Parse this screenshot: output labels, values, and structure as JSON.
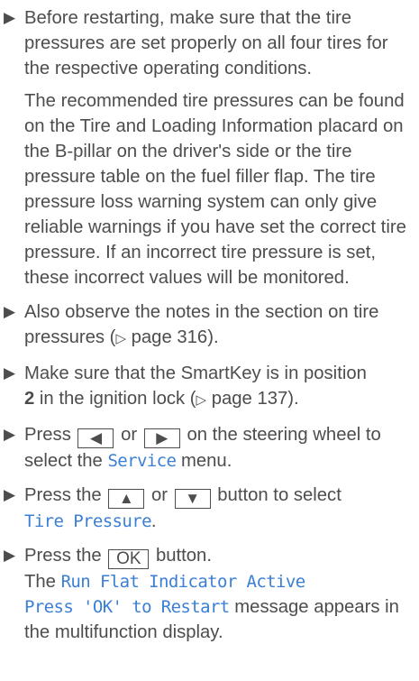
{
  "step1": {
    "text": "Before restarting, make sure that the tire pressures are set properly on all four tires for the respective operating conditions."
  },
  "note1": {
    "text": "The recommended tire pressures can be found on the Tire and Loading Information placard on the B-pillar on the driver's side or the tire pressure table on the fuel filler flap. The tire pressure loss warning system can only give reliable warnings if you have set the correct tire pressure. If an incorrect tire pressure is set, these incorrect values will be monitored."
  },
  "step2": {
    "text": "Also observe the notes in the section on tire pressures (",
    "page_symbol": "▷",
    "page_ref": " page 316)."
  },
  "step3": {
    "text": "Make sure that the SmartKey is in position",
    "position": "2",
    "text2": " in the ignition lock (",
    "page_symbol": "▷",
    "page_ref": " page 137)."
  },
  "step4": {
    "press": "Press",
    "key_left": "◀",
    "or": "or",
    "key_right": "▶",
    "text": "on the steering wheel to select the",
    "menu": "Service",
    "tail": "menu."
  },
  "step5": {
    "press": "Press the",
    "key_up": "▲",
    "or": "or",
    "key_down": "▼",
    "text": "button to select",
    "menu": "Tire Pressure",
    "tail": "."
  },
  "step6": {
    "press": "Press the",
    "key_ok": "OK",
    "text": "button.",
    "result_pre": "The",
    "message_line1": "Run Flat Indicator Active",
    "message_line2": "Press 'OK' to Restart",
    "result_post": "message appears in the multifunction display."
  }
}
